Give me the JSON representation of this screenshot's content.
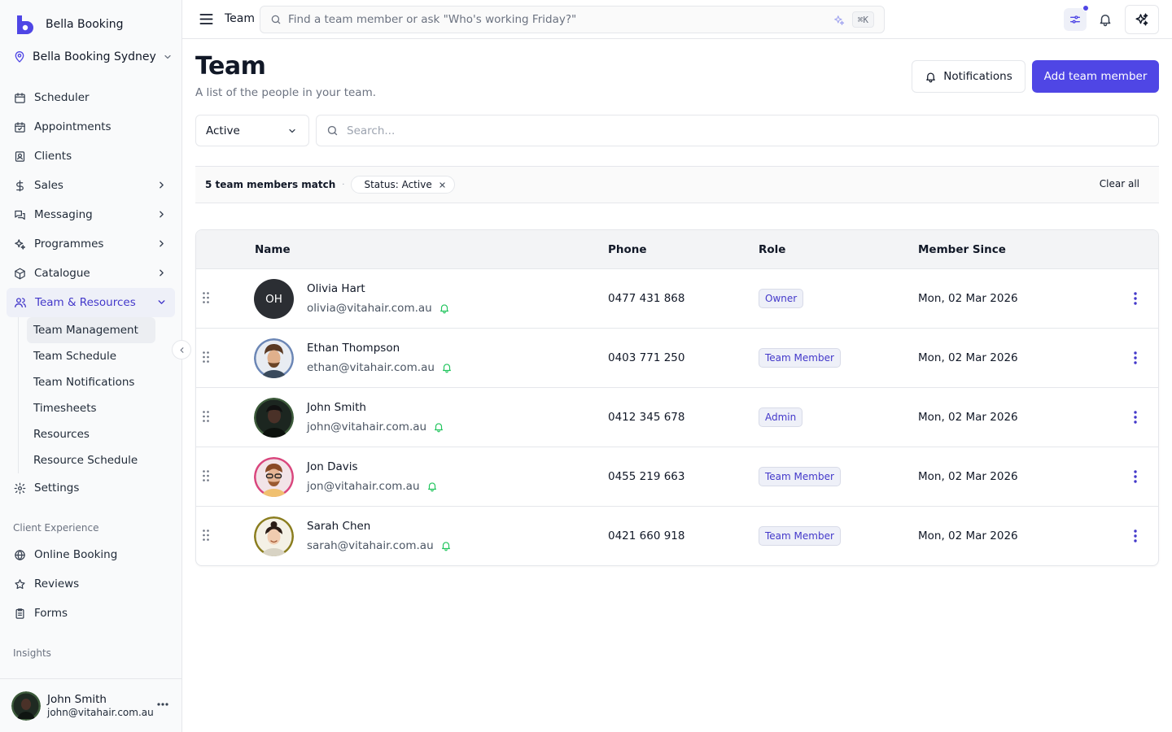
{
  "app": {
    "name": "Bella Booking",
    "location": "Bella Booking Sydney"
  },
  "sidebar": {
    "items": [
      {
        "label": "Scheduler",
        "icon": "calendar-icon"
      },
      {
        "label": "Appointments",
        "icon": "calendar-check-icon"
      },
      {
        "label": "Clients",
        "icon": "contact-icon"
      },
      {
        "label": "Sales",
        "icon": "dollar-icon"
      },
      {
        "label": "Messaging",
        "icon": "chat-icon"
      },
      {
        "label": "Programmes",
        "icon": "sparkle-icon"
      },
      {
        "label": "Catalogue",
        "icon": "box-icon"
      },
      {
        "label": "Team & Resources",
        "icon": "users-icon"
      }
    ],
    "sub_items": [
      "Team Management",
      "Team Schedule",
      "Team Notifications",
      "Timesheets",
      "Resources",
      "Resource Schedule"
    ],
    "settings": "Settings",
    "group_client_experience": "Client Experience",
    "client_items": [
      "Online Booking",
      "Reviews",
      "Forms"
    ],
    "group_insights": "Insights",
    "user": {
      "name": "John Smith",
      "email": "john@vitahair.com.au"
    }
  },
  "topbar": {
    "crumb": "Team",
    "search_placeholder": "Find a team member or ask \"Who's working Friday?\"",
    "shortcut": "⌘K"
  },
  "page": {
    "title": "Team",
    "subtitle": "A list of the people in your team.",
    "notifications_label": "Notifications",
    "add_label": "Add team member",
    "status_value": "Active",
    "search_placeholder": "Search...",
    "match_text": "5 team members match",
    "chip_label": "Status: Active",
    "clear_all": "Clear all"
  },
  "table": {
    "headers": {
      "name": "Name",
      "phone": "Phone",
      "role": "Role",
      "since": "Member Since"
    },
    "rows": [
      {
        "name": "Olivia Hart",
        "email": "olivia@vitahair.com.au",
        "phone": "0477 431 868",
        "role": "Owner",
        "since": "Mon, 02 Mar 2026",
        "initials": "OH"
      },
      {
        "name": "Ethan Thompson",
        "email": "ethan@vitahair.com.au",
        "phone": "0403 771 250",
        "role": "Team Member",
        "since": "Mon, 02 Mar 2026"
      },
      {
        "name": "John Smith",
        "email": "john@vitahair.com.au",
        "phone": "0412 345 678",
        "role": "Admin",
        "since": "Mon, 02 Mar 2026"
      },
      {
        "name": "Jon Davis",
        "email": "jon@vitahair.com.au",
        "phone": "0455 219 663",
        "role": "Team Member",
        "since": "Mon, 02 Mar 2026"
      },
      {
        "name": "Sarah Chen",
        "email": "sarah@vitahair.com.au",
        "phone": "0421 660 918",
        "role": "Team Member",
        "since": "Mon, 02 Mar 2026"
      }
    ]
  },
  "colors": {
    "accent": "#4f46e5",
    "bell_on": "#22c55e",
    "role_text": "#4338ca"
  }
}
